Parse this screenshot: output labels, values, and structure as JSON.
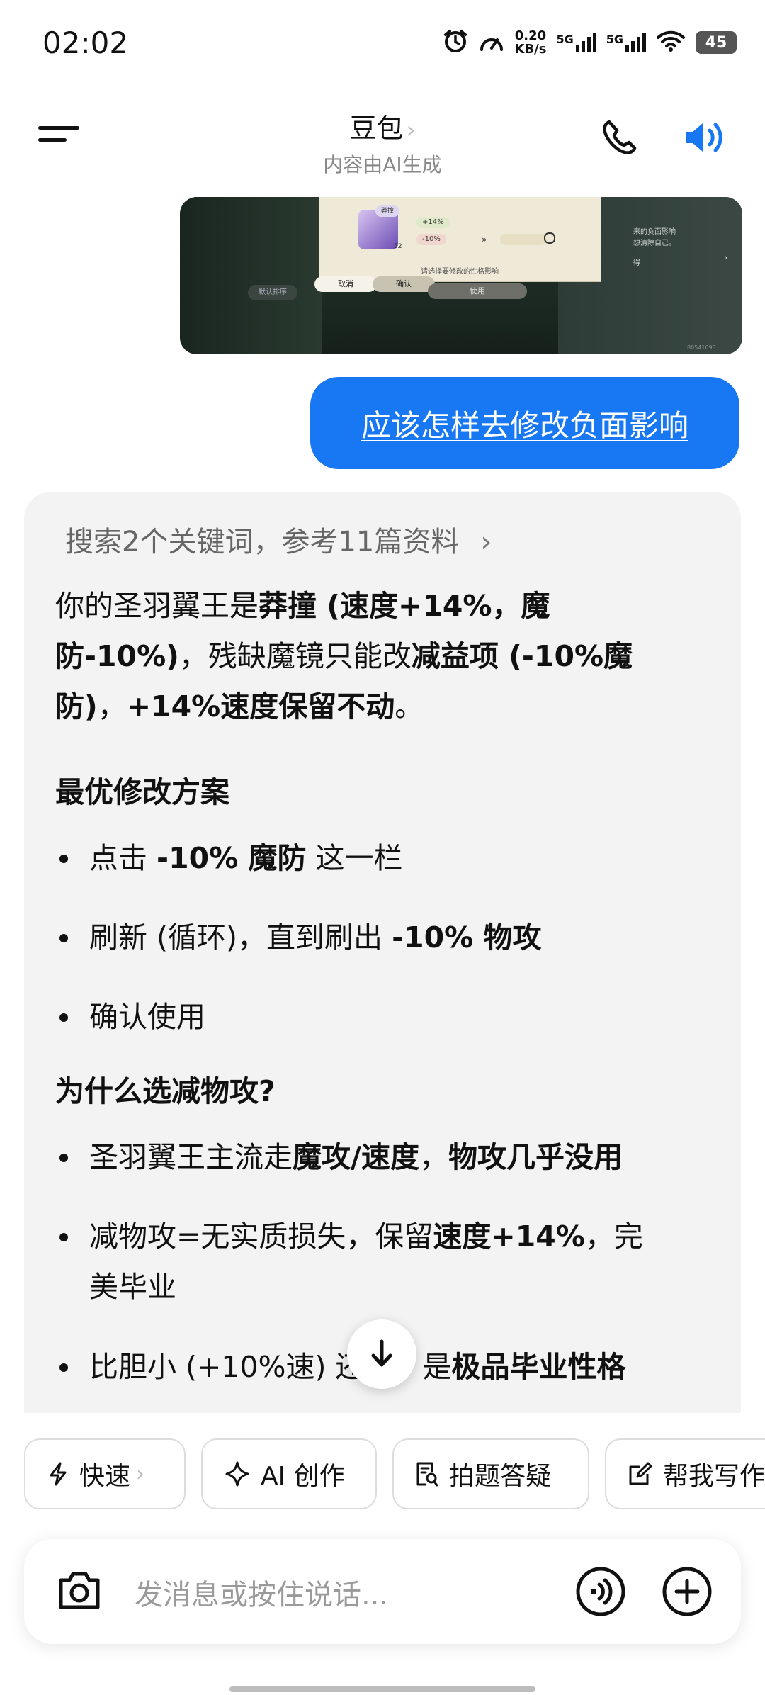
{
  "status_bar": {
    "time": "02:02",
    "net_speed_value": "0.20",
    "net_speed_unit": "KB/s",
    "sim1": "5G",
    "sim2": "5G",
    "battery": "45"
  },
  "header": {
    "title": "豆包",
    "title_chevron": "›",
    "subtitle": "内容由AI生成"
  },
  "game_screenshot": {
    "tag": "莽撞",
    "level": "52",
    "stat_up": "+14%",
    "stat_down": "-10%",
    "arrows": "»",
    "caption": "请选择要修改的性格影响",
    "cancel": "取消",
    "confirm": "确认",
    "use": "使用",
    "sort": "默认排序",
    "side_text_1": "来的负面影响",
    "side_text_2": "想清除自己。",
    "side_text_3": "得",
    "code": "80541093"
  },
  "user_message": "应该怎样去修改负面影响",
  "ai_message": {
    "search_summary": "搜索2个关键词，参考11篇资料",
    "search_chevron": "›",
    "p1_a": "你的圣羽翼王是",
    "p1_b": "莽撞 (速度+14%，魔",
    "p1_c": "防-10%)",
    "p1_d": "，残缺魔镜只能改",
    "p1_e": "减益项 (-10%魔",
    "p1_f": "防)",
    "p1_g": "，",
    "p1_h": "+14%速度保留不动",
    "p1_i": "。",
    "h1": "最优修改方案",
    "b1_a": "点击 ",
    "b1_b": "-10% 魔防",
    "b1_c": " 这一栏",
    "b2_a": "刷新 (循环)，直到刷出 ",
    "b2_b": "-10% 物攻",
    "b3": "确认使用",
    "h2": "为什么选减物攻?",
    "b4_a": "圣羽翼王主流走",
    "b4_b": "魔攻/速度",
    "b4_c": "，",
    "b4_d": "物攻几乎没用",
    "b5_a": "减物攻=无实质损失，保留",
    "b5_b": "速度+14%",
    "b5_c": "，完",
    "b5_d": "美毕业",
    "b6_a": "比胆小 (+10%速) 还快，是",
    "b6_b": "极品毕业性格"
  },
  "chips": [
    {
      "label": "快速",
      "chevron": "›"
    },
    {
      "label": "AI 创作"
    },
    {
      "label": "拍题答疑"
    },
    {
      "label": "帮我写作"
    }
  ],
  "input": {
    "placeholder": "发消息或按住说话..."
  },
  "colors": {
    "accent": "#1877f2",
    "card_bg": "#f3f3f3"
  }
}
